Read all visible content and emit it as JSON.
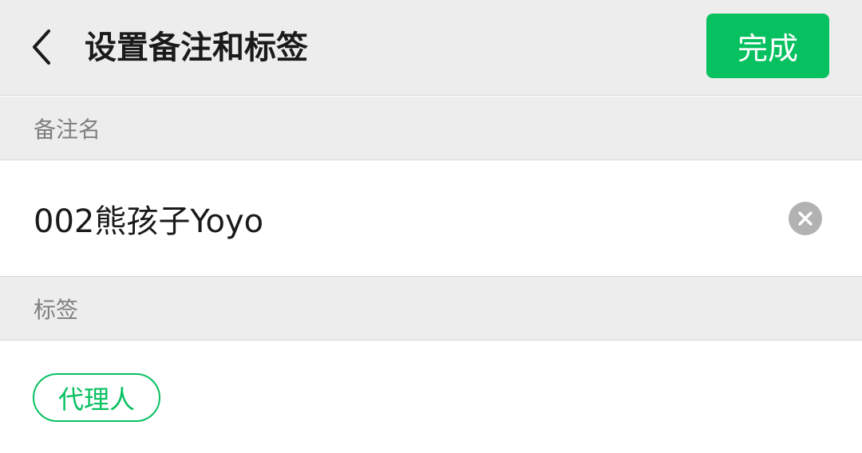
{
  "header": {
    "title": "设置备注和标签",
    "done_label": "完成",
    "back_icon": "chevron-left-icon"
  },
  "remark": {
    "section_label": "备注名",
    "value": "002熊孩子Yoyo",
    "clear_icon": "clear-circle-icon"
  },
  "tags": {
    "section_label": "标签",
    "items": [
      "代理人"
    ]
  },
  "colors": {
    "accent": "#07c160",
    "header_bg": "#ededed",
    "section_label_text": "#7f7f7f",
    "clear_icon_bg": "#b2b2b2"
  }
}
